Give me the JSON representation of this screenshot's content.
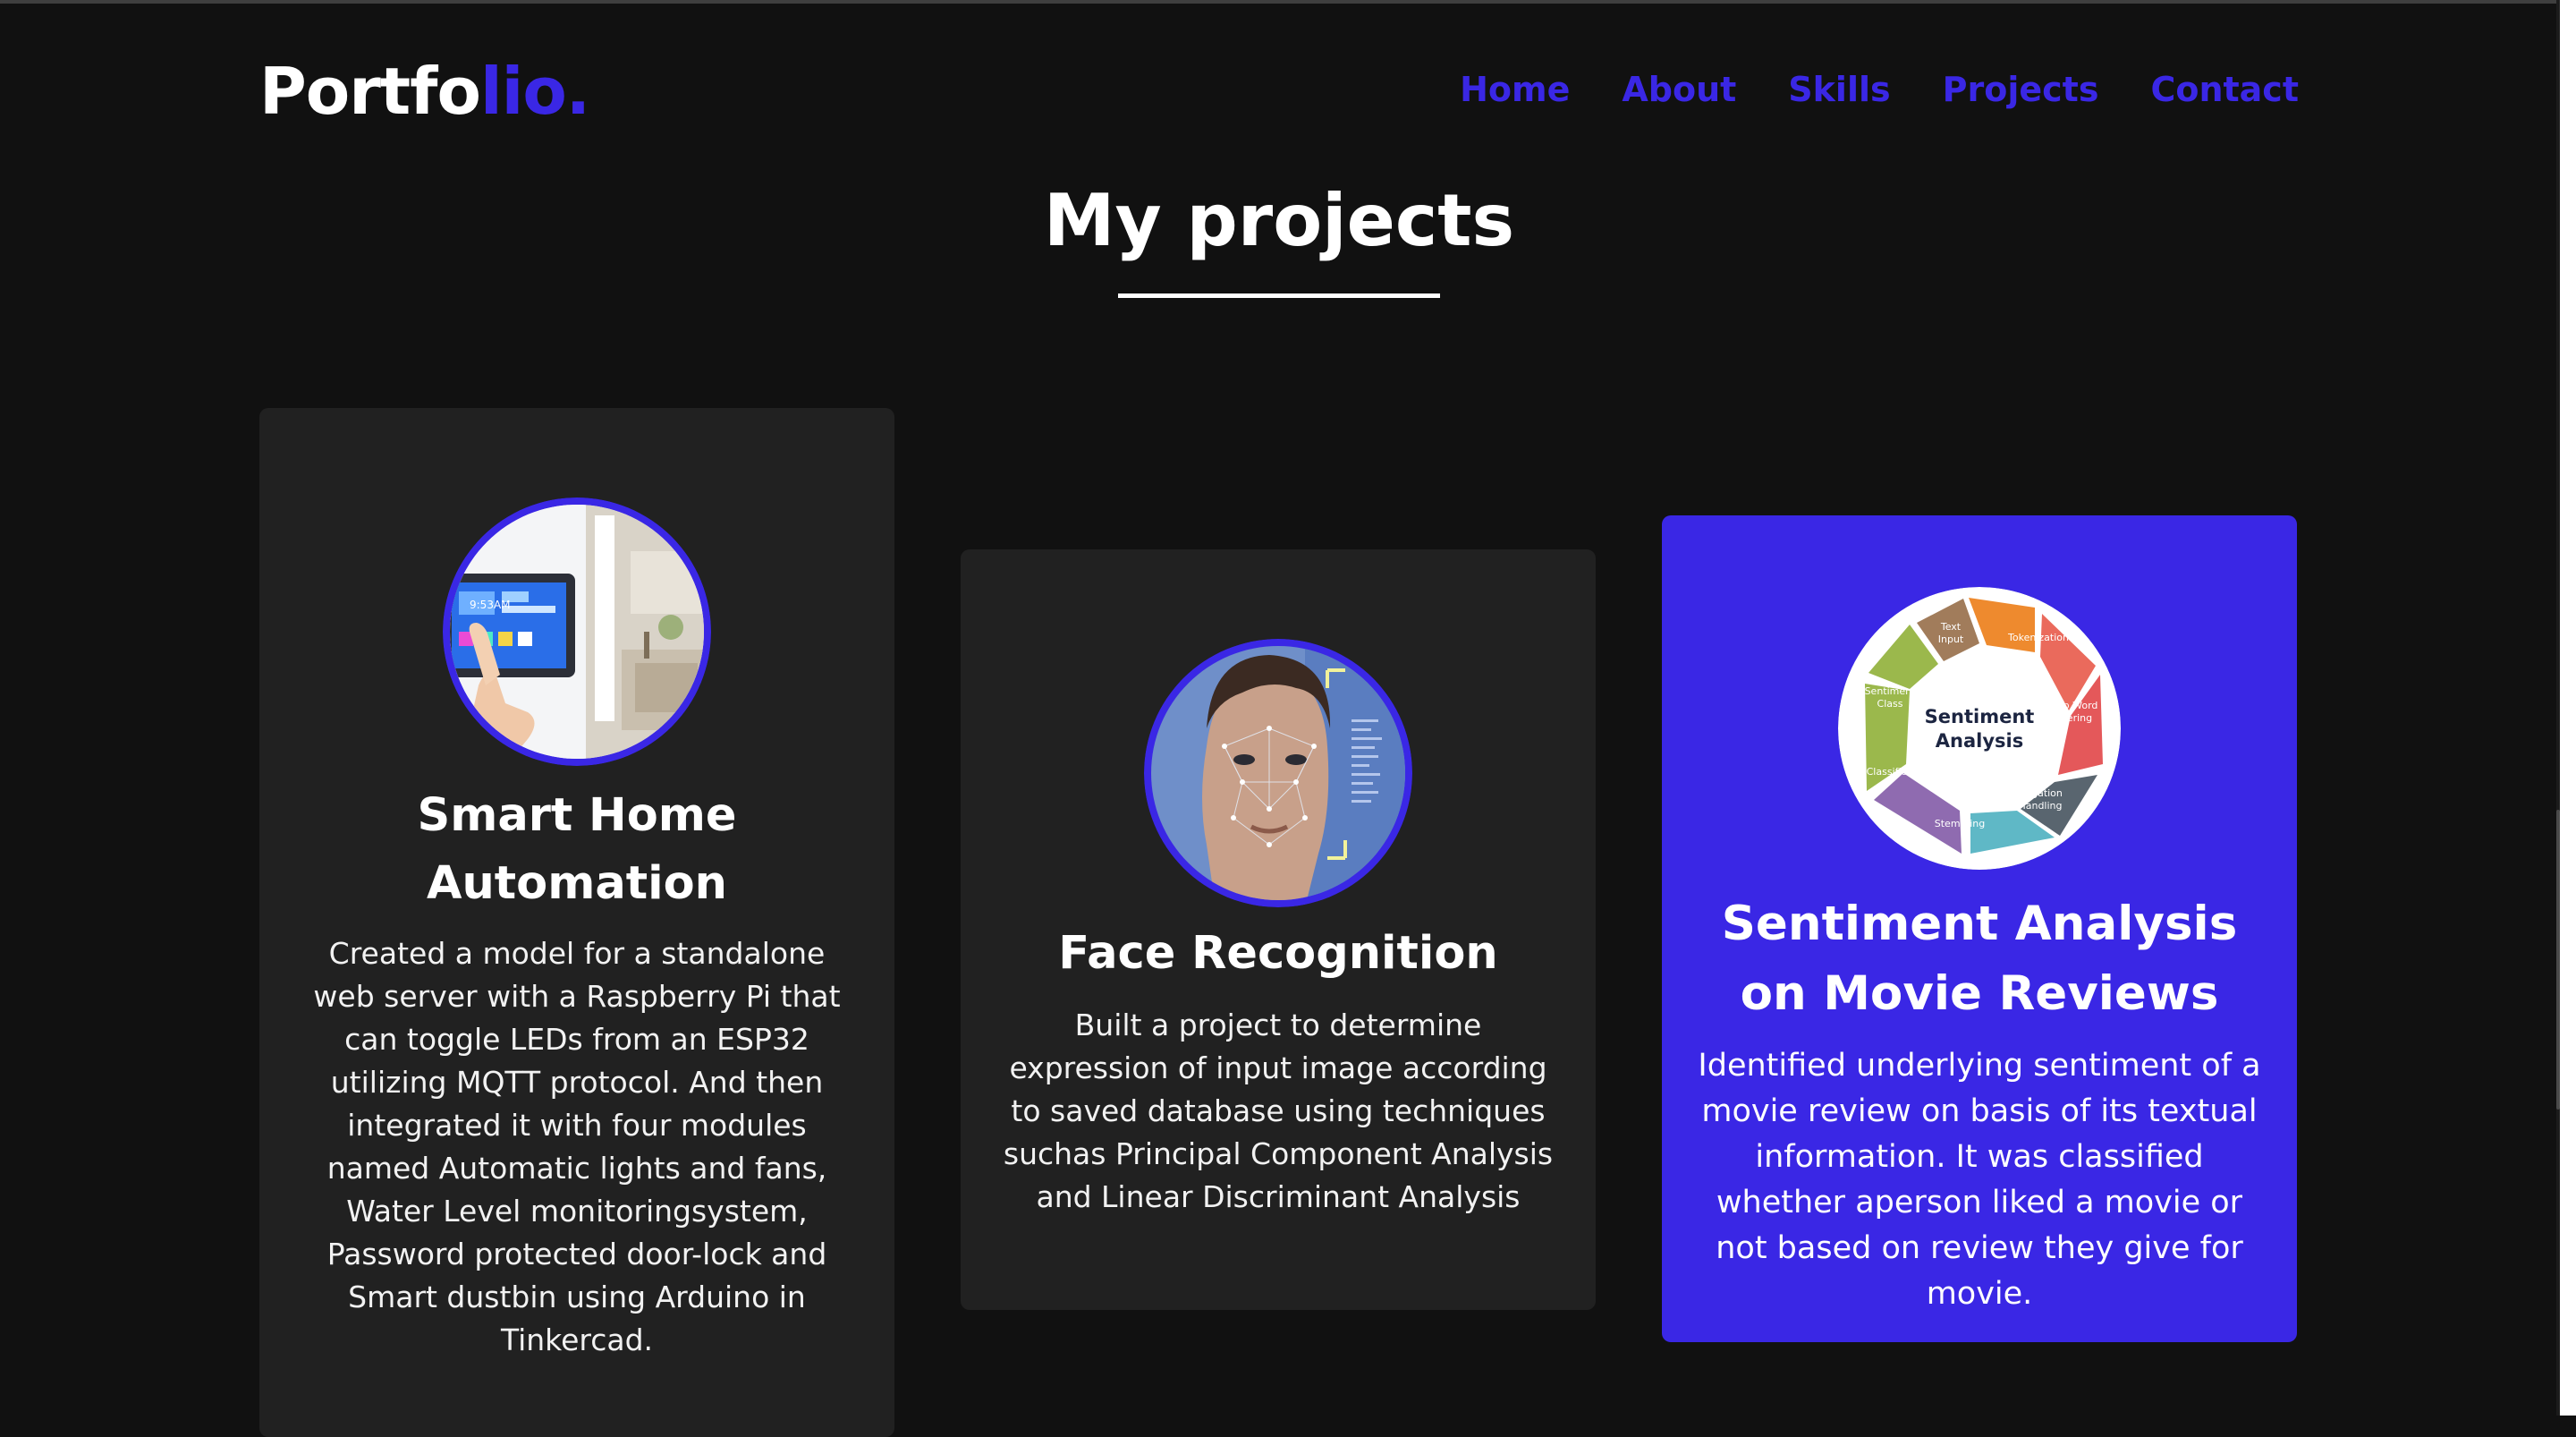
{
  "brand": {
    "main": "Portfo",
    "accent": "lio."
  },
  "nav": {
    "home": "Home",
    "about": "About",
    "skills": "Skills",
    "projects": "Projects",
    "contact": "Contact"
  },
  "section": {
    "title": "My projects"
  },
  "projects": [
    {
      "title": "Smart Home Automation",
      "description": "Created a model for a standalone web server with a Raspberry Pi that can toggle LEDs from an ESP32 utilizing MQTT protocol. And then integrated it with four modules named Automatic lights and fans, Water Level monitoringsystem, Password protected door-lock and Smart dustbin using Arduino in Tinkercad.",
      "image": {
        "screen_text": "9:53AM"
      }
    },
    {
      "title": "Face Recognition",
      "description": "Built a project to determine expression of input image according to saved database using techniques suchas Principal Component Analysis and Linear Discriminant Analysis"
    },
    {
      "title": "Sentiment Analysis on Movie Reviews",
      "description": "Identified underlying sentiment of a movie review on basis of its textual information. It was classified whether aperson liked a movie or not based on review they give for movie.",
      "image": {
        "center_line1": "Sentiment",
        "center_line2": "Analysis",
        "seg_text_input_1": "Text",
        "seg_text_input_2": "Input",
        "seg_tokenization": "Tokenization",
        "seg_stop_word_1": "Stop Word",
        "seg_stop_word_2": "Filtering",
        "seg_negation_1": "Negation",
        "seg_negation_2": "Handling",
        "seg_stemming": "Stemming",
        "seg_classification": "Classification",
        "seg_sentiment_class_1": "Sentiment",
        "seg_sentiment_class_2": "Class"
      }
    }
  ],
  "colors": {
    "accent": "#3a27e5",
    "background": "#111111",
    "card": "#212121",
    "text": "#ffffff"
  }
}
